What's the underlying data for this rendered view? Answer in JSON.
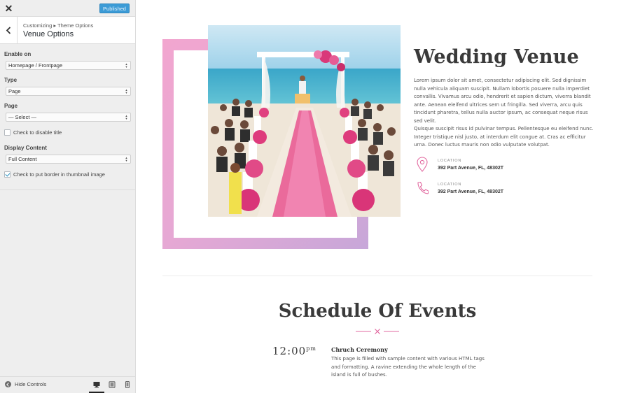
{
  "customizer": {
    "publish_label": "Published",
    "breadcrumb": "Customizing ▸ Theme Options",
    "panel_title": "Venue Options",
    "controls": {
      "enable_on": {
        "label": "Enable on",
        "value": "Homepage / Frontpage"
      },
      "type": {
        "label": "Type",
        "value": "Page"
      },
      "page": {
        "label": "Page",
        "value": "— Select —"
      },
      "disable_title": {
        "label": "Check to disable title",
        "checked": false
      },
      "display_content": {
        "label": "Display Content",
        "value": "Full Content"
      },
      "thumbnail_border": {
        "label": "Check to put border in thumbnail image",
        "checked": true
      }
    },
    "footer": {
      "hide_controls_label": "Hide Controls",
      "devices": [
        "desktop-icon",
        "tablet-icon",
        "mobile-icon"
      ],
      "active_device": "desktop"
    }
  },
  "venue": {
    "title": "Wedding Venue",
    "paragraph1": "Lorem ipsum dolor sit amet, consectetur adipiscing elit. Sed dignissim nulla vehicula aliquam suscipit. Nullam lobortis posuere nulla imperdiet convallis. Vivamus arcu odio, hendrerit et sapien dictum, viverra blandit ante. Aenean eleifend ultrices sem ut fringilla. Sed viverra, arcu quis tincidunt pharetra, tellus nulla auctor ipsum, ac consequat neque risus sed velit.",
    "paragraph2": "Quisque suscipit risus id pulvinar tempus. Pellentesque eu eleifend nunc. Integer tristique nisl justo, at interdum elit congue at. Cras ac efficitur urna. Donec luctus mauris non odio vulputate volutpat.",
    "info": [
      {
        "icon": "map-pin-icon",
        "label": "LOCATION",
        "value": "392 Part Avenue, FL, 48302T"
      },
      {
        "icon": "phone-icon",
        "label": "LOCATION",
        "value": "392 Part Avenue, FL, 48302T"
      }
    ]
  },
  "schedule": {
    "title": "Schedule Of Events",
    "event": {
      "time": "12:00",
      "time_suffix": "pm",
      "title": "Chruch Ceremony",
      "description": "This page is filled with sample content with various HTML tags and formatting. A ravine extending the whole length of the island is full of bushes."
    }
  },
  "colors": {
    "accent": "#e26aa0",
    "publish_button": "#3c9bd6",
    "frame_gradient_start": "#f2a6cf",
    "frame_gradient_end": "#c7a7d9"
  }
}
